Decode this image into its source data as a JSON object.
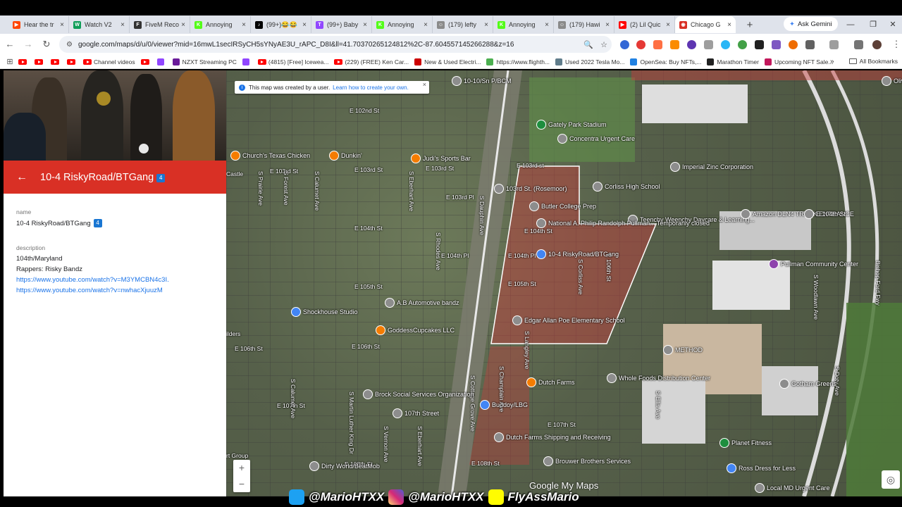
{
  "tabs": [
    {
      "title": "Hear the tr",
      "color": "#ff4500",
      "glyph": "▶",
      "active": false
    },
    {
      "title": "Watch V2",
      "color": "#0f9d58",
      "glyph": "W",
      "active": false
    },
    {
      "title": "FiveM Reco",
      "color": "#333333",
      "glyph": "F",
      "active": false
    },
    {
      "title": "Annoying",
      "color": "#53fc18",
      "glyph": "K",
      "active": false
    },
    {
      "title": "(99+)😂😂",
      "color": "#000000",
      "glyph": "♪",
      "active": false
    },
    {
      "title": "(99+) Baby",
      "color": "#9146ff",
      "glyph": "T",
      "active": false
    },
    {
      "title": "Annoying",
      "color": "#53fc18",
      "glyph": "K",
      "active": false
    },
    {
      "title": "(179) lefty",
      "color": "#8a8a8a",
      "glyph": "☺",
      "active": false
    },
    {
      "title": "Annoying",
      "color": "#53fc18",
      "glyph": "K",
      "active": false
    },
    {
      "title": "(179) Hawi",
      "color": "#8a8a8a",
      "glyph": "☺",
      "active": false
    },
    {
      "title": "(2) Lil Quic",
      "color": "#ff0000",
      "glyph": "▶",
      "active": false
    },
    {
      "title": "Chicago G",
      "color": "#d93025",
      "glyph": "◉",
      "active": true
    }
  ],
  "browser": {
    "ask_gemini": "Ask Gemini",
    "url": "google.com/maps/d/u/0/viewer?mid=16mwL1secIRSyCH5sYNyAE3U_rAPC_D8I&ll=41.70370265124812%2C-87.604557145266288&z=16",
    "bookmarks": [
      {
        "label": "",
        "type": "yt"
      },
      {
        "label": "",
        "type": "yt"
      },
      {
        "label": "",
        "type": "yt"
      },
      {
        "label": "",
        "type": "yt"
      },
      {
        "label": "Channel videos",
        "type": "yt"
      },
      {
        "label": "",
        "type": "yt"
      },
      {
        "label": "",
        "type": "tw"
      },
      {
        "label": "NZXT Streaming PC",
        "type": "nz"
      },
      {
        "label": "",
        "type": "tw"
      },
      {
        "label": "(4815) [Free] Icewea...",
        "type": "yt"
      },
      {
        "label": "(229) (FREE) Ken Car...",
        "type": "yt"
      },
      {
        "label": "New & Used Electri...",
        "type": "ts"
      },
      {
        "label": "https://www.flighth...",
        "type": "fl"
      },
      {
        "label": "Used 2022 Tesla Mo...",
        "type": "ca"
      },
      {
        "label": "OpenSea: Buy NFTs,...",
        "type": "os"
      },
      {
        "label": "Marathon Timer",
        "type": "mt"
      },
      {
        "label": "Upcoming NFT Sale...",
        "type": "nf"
      }
    ],
    "all_bookmarks": "All Bookmarks"
  },
  "panel": {
    "title": "10-4 RiskyRoad/BTGang",
    "badge": "4",
    "name_label": "name",
    "name_value": "10-4 RiskyRoad/BTGang",
    "description_label": "description",
    "desc_line1": "104th/Maryland",
    "desc_line2": "Rappers: Risky Bandz",
    "link1": "https://www.youtube.com/watch?v=M3YMCBN4c3I.",
    "link2": "https://www.youtube.com/watch?v=nwhacXjuuzM"
  },
  "map": {
    "info_text": "This map was created by a user.",
    "info_link": "Learn how to create your own.",
    "zoom_in": "+",
    "zoom_out": "−",
    "watermark": "Google My Maps",
    "colors": {
      "territory_fill": "rgba(200,60,60,0.45)",
      "territory_stroke": "#ffffff"
    },
    "streets": [
      {
        "text": "E 102nd St"
      },
      {
        "text": "E 103rd St"
      },
      {
        "text": "E 103rd St"
      },
      {
        "text": "E 103rd St"
      },
      {
        "text": "E 103rd Pl"
      },
      {
        "text": "E 104th St"
      },
      {
        "text": "E 104th Pl"
      },
      {
        "text": "E 105th St"
      },
      {
        "text": "E 105th St"
      },
      {
        "text": "E 106th St"
      },
      {
        "text": "E 106th St"
      },
      {
        "text": "E 107th St"
      },
      {
        "text": "E 107th St"
      },
      {
        "text": "E 108th St"
      },
      {
        "text": "E 108th St"
      },
      {
        "text": "E 103rd st"
      },
      {
        "text": "E 104th St"
      },
      {
        "text": "E 104th Pl"
      },
      {
        "text": "Castle"
      },
      {
        "text": "ilders"
      },
      {
        "text": "rt Group"
      }
    ],
    "vstreets": [
      {
        "text": "S Prairie Ave"
      },
      {
        "text": "S Forest Ave"
      },
      {
        "text": "S Calumet Ave"
      },
      {
        "text": "S Calumet Ave"
      },
      {
        "text": "S Vernon Ave"
      },
      {
        "text": "S Eberhart Ave"
      },
      {
        "text": "S Rhodes Ave"
      },
      {
        "text": "S Eberhart Ave"
      },
      {
        "text": "S Dauphin Ave"
      },
      {
        "text": "S Cottage Grove Ave"
      },
      {
        "text": "S Martin Luther King Dr"
      },
      {
        "text": "S Corliss Ave"
      },
      {
        "text": "E 106th St"
      },
      {
        "text": "S Woodlawn Ave"
      },
      {
        "text": "Bishop Ford Fwy"
      },
      {
        "text": "S Doty Ave"
      },
      {
        "text": "S Ellis Ave"
      },
      {
        "text": "S Champlain Ave"
      },
      {
        "text": "S Langley Ave"
      }
    ],
    "pois": [
      {
        "text": "Church's Texas Chicken",
        "pin": "orange"
      },
      {
        "text": "Dunkin'",
        "pin": "orange"
      },
      {
        "text": "Judi's Sports Bar",
        "pin": "orange"
      },
      {
        "text": "Gately Park Stadium",
        "pin": "green"
      },
      {
        "text": "Concentra Urgent Care",
        "pin": "gray"
      },
      {
        "text": "Imperial Zinc Corporation",
        "pin": "gray"
      },
      {
        "text": "Corliss High School",
        "pin": "gray"
      },
      {
        "text": "Butler College Prep",
        "pin": "gray"
      },
      {
        "text": "Teenchy Weenchy Daycare & Learning...",
        "pin": "gray"
      },
      {
        "text": "National A. Philip Randolph Pullman... Temporarily closed",
        "pin": "gray"
      },
      {
        "text": "Amazon DLN4 TRUCK ENTRANCE",
        "pin": "gray"
      },
      {
        "text": "E 104th St",
        "pin": "gray"
      },
      {
        "text": "Pullman Community Center",
        "pin": "purple"
      },
      {
        "text": "10-4 RiskyRoad/BTGang",
        "pin": "blue"
      },
      {
        "text": "103rd St. (Rosemoor)",
        "pin": "gray"
      },
      {
        "text": "Edgar Allan Poe Elementary School",
        "pin": "gray"
      },
      {
        "text": "A.B Automotive bandz",
        "pin": "gray"
      },
      {
        "text": "Shockhouse Studio",
        "pin": "blue"
      },
      {
        "text": "GoddessCupcakes LLC",
        "pin": "orange"
      },
      {
        "text": "METHOD",
        "pin": "gray"
      },
      {
        "text": "Whole Foods Distribution Center",
        "pin": "gray"
      },
      {
        "text": "Gotham Greens",
        "pin": "gray"
      },
      {
        "text": "Dutch Farms",
        "pin": "orange"
      },
      {
        "text": "Brock Social Services Organization",
        "pin": "gray"
      },
      {
        "text": "107th Street",
        "pin": "gray"
      },
      {
        "text": "Dutch Farms Shipping and Receiving",
        "pin": "gray"
      },
      {
        "text": "Brouwer Brothers Services",
        "pin": "gray"
      },
      {
        "text": "Planet Fitness",
        "pin": "green"
      },
      {
        "text": "Ross Dress for Less",
        "pin": "blue"
      },
      {
        "text": "Local MD Urgent Care",
        "pin": "gray"
      },
      {
        "text": "Olive-Ha",
        "pin": "gray"
      },
      {
        "text": "Dirty World/BeatMob",
        "pin": "gray"
      },
      {
        "text": "Buddoy/LBG",
        "pin": "blue"
      },
      {
        "text": "10-10/Sn P/BCM",
        "pin": "gray"
      }
    ]
  },
  "social": {
    "twitter": "@MarioHTXX",
    "instagram": "@MarioHTXX",
    "snapchat": "FlyAssMario"
  }
}
